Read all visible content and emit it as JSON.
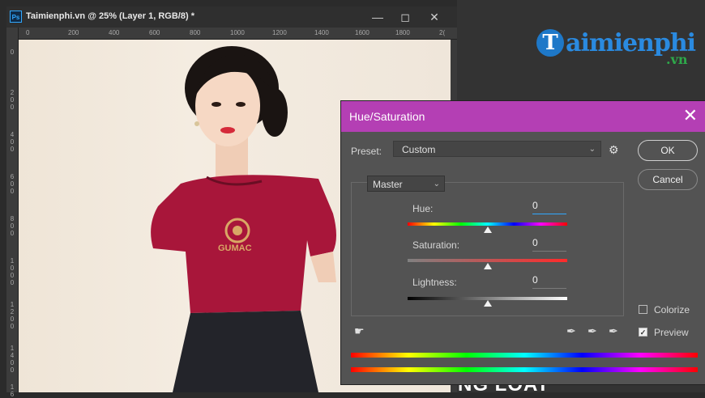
{
  "document": {
    "title": "Taimienphi.vn @ 25% (Layer 1, RGB/8) *",
    "ps_badge": "Ps",
    "ruler_top_ticks": [
      "0",
      "200",
      "400",
      "600",
      "800",
      "1000",
      "1200",
      "1400",
      "1600",
      "1800",
      "2("
    ],
    "ruler_left_ticks": [
      "0",
      "2",
      "0",
      "0",
      "4",
      "0",
      "0",
      "6",
      "0",
      "0",
      "8",
      "0",
      "0",
      "1",
      "0",
      "0",
      "0",
      "1",
      "2",
      "0",
      "0",
      "1",
      "4",
      "0",
      "0",
      "1",
      "6"
    ],
    "window_buttons": {
      "minimize": "—",
      "restore": "◻",
      "close": "✕"
    }
  },
  "canvas": {
    "shirt_logo_text": "GUMAC"
  },
  "logo": {
    "initial": "T",
    "text": "aimienphi",
    "suffix": ".vn"
  },
  "background_text": "NG LOAT",
  "dialog": {
    "title": "Hue/Saturation",
    "close": "✕",
    "preset_label": "Preset:",
    "preset_value": "Custom",
    "ok_label": "OK",
    "cancel_label": "Cancel",
    "channel": "Master",
    "sliders": [
      {
        "label": "Hue:",
        "value": "0"
      },
      {
        "label": "Saturation:",
        "value": "0"
      },
      {
        "label": "Lightness:",
        "value": "0"
      }
    ],
    "colorize_label": "Colorize",
    "colorize_checked": false,
    "preview_label": "Preview",
    "preview_checked": true
  },
  "colors": {
    "dialog_titlebar": "#b43fb4",
    "shirt": "#a8163a",
    "logo_blue": "#1e78c8",
    "logo_green": "#2ea84a"
  }
}
